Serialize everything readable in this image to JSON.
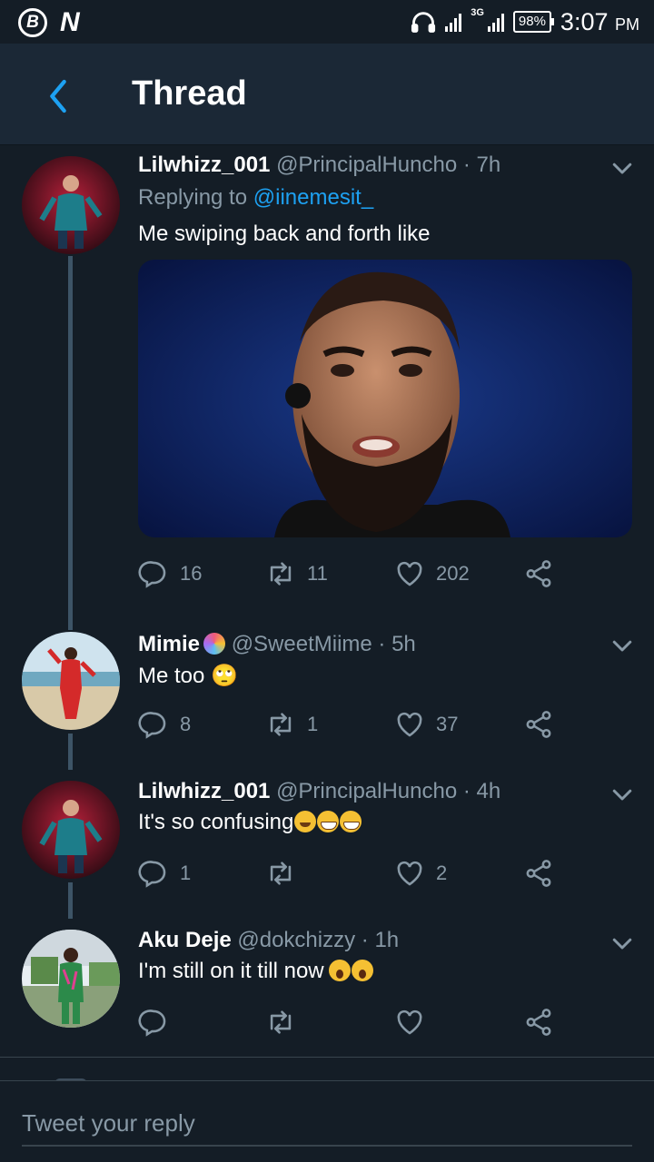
{
  "status_bar": {
    "time": "3:07",
    "ampm": "PM",
    "battery": "98%",
    "network": "3G"
  },
  "header": {
    "title": "Thread"
  },
  "tweets": [
    {
      "name": "Lilwhizz_001",
      "handle": "@PrincipalHuncho",
      "time": "· 7h",
      "replying_label": "Replying to",
      "replying_to": "@iinemesit_",
      "text": "Me swiping back and forth like",
      "replies": "16",
      "retweets": "11",
      "likes": "202"
    },
    {
      "name": "Mimie",
      "handle": "@SweetMiime",
      "time": "· 5h",
      "text": "Me too 🙄",
      "replies": "8",
      "retweets": "1",
      "likes": "37"
    },
    {
      "name": "Lilwhizz_001",
      "handle": "@PrincipalHuncho",
      "time": "· 4h",
      "text": "It's so confusing",
      "replies": "1",
      "retweets": "",
      "likes": "2"
    },
    {
      "name": "Aku Deje",
      "handle": "@dokchizzy",
      "time": "· 1h",
      "text": "I'm still on it till now",
      "replies": "",
      "retweets": "",
      "likes": ""
    }
  ],
  "composer": {
    "placeholder": "Tweet your reply"
  },
  "colors": {
    "background": "#141d26",
    "header": "#1b2836",
    "accent": "#1da1f2",
    "muted": "#8899a6"
  }
}
